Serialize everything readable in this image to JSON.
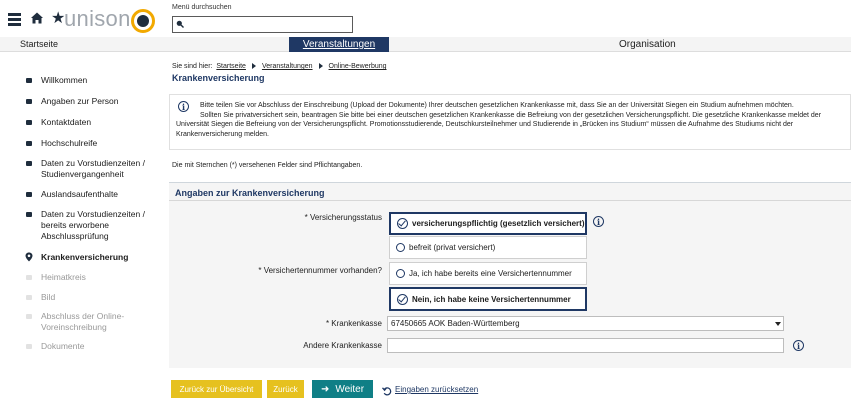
{
  "header": {
    "logo_text": "unison",
    "search_label": "Menü durchsuchen",
    "search_value": ""
  },
  "nav": {
    "start": "Startseite",
    "active": "Veranstaltungen",
    "org": "Organisation"
  },
  "sidebar": {
    "items": [
      {
        "label": "Willkommen",
        "state": "done"
      },
      {
        "label": "Angaben zur Person",
        "state": "done"
      },
      {
        "label": "Kontaktdaten",
        "state": "done"
      },
      {
        "label": "Hochschulreife",
        "state": "done"
      },
      {
        "label": "Daten zu Vorstudienzeiten / Studienvergangenheit",
        "state": "done"
      },
      {
        "label": "Auslandsaufenthalte",
        "state": "done"
      },
      {
        "label": "Daten zu Vorstudienzeiten / bereits erworbene Abschlussprüfung",
        "state": "done"
      },
      {
        "label": "Krankenversicherung",
        "state": "active"
      },
      {
        "label": "Heimatkreis",
        "state": "disabled"
      },
      {
        "label": "Bild",
        "state": "disabled"
      },
      {
        "label": "Abschluss der Online-Voreinschreibung",
        "state": "disabled"
      },
      {
        "label": "Dokumente",
        "state": "disabled"
      }
    ]
  },
  "breadcrumb": {
    "prefix": "Sie sind hier:",
    "items": [
      "Startseite",
      "Veranstaltungen",
      "Online-Bewerbung"
    ]
  },
  "page_title": "Krankenversicherung",
  "info": {
    "line1": "Bitte teilen Sie vor Abschluss der Einschreibung (Upload der Dokumente) Ihrer deutschen gesetzlichen Krankenkasse mit, dass Sie an der Universität Siegen ein Studium aufnehmen möchten.",
    "line2": "Sollten Sie privatversichert sein, beantragen Sie bitte bei einer deutschen gesetzlichen Krankenkasse die Befreiung von der gesetzlichen Versicherungspflicht. Die gesetzliche Krankenkasse meldet der Universität Siegen die Befreiung von der Versicherungspflicht. Promotionsstudierende, Deutschkursteilnehmer und Studierende in „Brücken ins Studium“ müssen die Aufnahme des Studiums nicht der Krankenversicherung melden."
  },
  "required_note": "Die mit Sternchen (*) versehenen Felder sind Pflichtangaben.",
  "form": {
    "section_title": "Angaben zur Krankenversicherung",
    "status_label": "* Versicherungsstatus",
    "status_options": [
      {
        "label": "versicherungspflichtig (gesetzlich versichert)",
        "selected": true
      },
      {
        "label": "befreit (privat versichert)",
        "selected": false
      }
    ],
    "vnr_label": "* Versichertennummer vorhanden?",
    "vnr_options": [
      {
        "label": "Ja, ich habe bereits eine Versichertennummer",
        "selected": false
      },
      {
        "label": "Nein, ich habe keine Versichertennummer",
        "selected": true
      }
    ],
    "kasse_label": "* Krankenkasse",
    "kasse_value": "67450665 AOK Baden-Württemberg",
    "andere_label": "Andere Krankenkasse",
    "andere_value": ""
  },
  "buttons": {
    "back_overview": "Zurück zur Übersicht",
    "back": "Zurück",
    "next": "Weiter",
    "reset": "Eingaben zurücksetzen"
  },
  "colors": {
    "brand_dark": "#1f3864",
    "yellow": "#e6c11f",
    "teal": "#0f7f86",
    "logo_ring": "#f2a900"
  }
}
